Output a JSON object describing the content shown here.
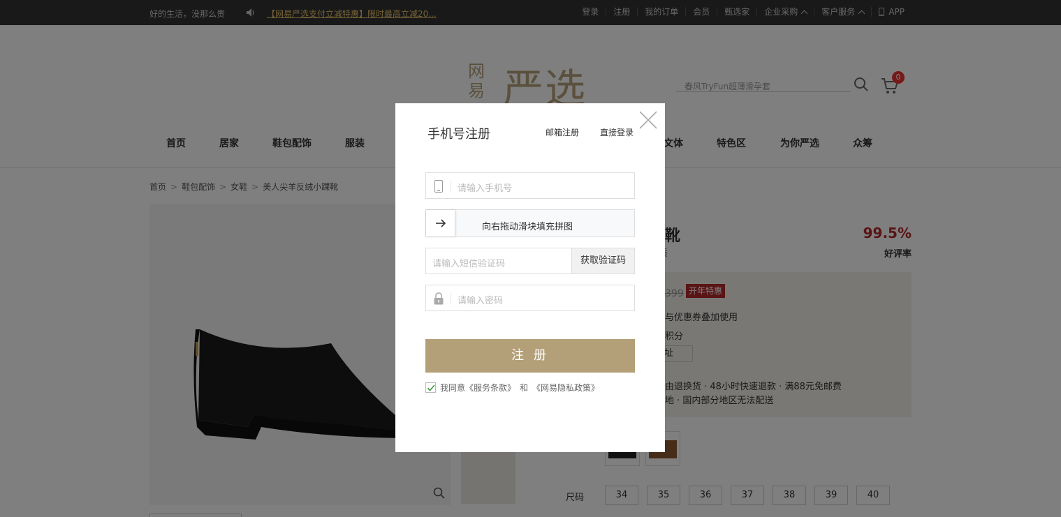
{
  "topbar": {
    "slogan": "好的生活，没那么贵",
    "notice": "【网易严选支付立减特惠】限时最高立减20...",
    "links": {
      "login": "登录",
      "register": "注册",
      "orders": "我的订单",
      "member": "会员",
      "curator": "甄选家",
      "enterprise": "企业采购",
      "service": "客户服务",
      "app": "APP"
    }
  },
  "header": {
    "logo_small": "网易",
    "logo_big": "严选",
    "search_placeholder": "春风TryFun超薄滑孕套",
    "cart_count": "0"
  },
  "nav": [
    "首页",
    "居家",
    "鞋包配饰",
    "服装",
    "文体",
    "特色区",
    "为你严选",
    "众筹"
  ],
  "breadcrumb": [
    "首页",
    "鞋包配饰",
    "女鞋",
    "美人尖羊反绒小踝靴"
  ],
  "product": {
    "title_tail": "踝靴",
    "subtitle_tail": "气质",
    "rate": "99.5%",
    "rate_label": "好评率",
    "old_price_tail": "399",
    "promo_tag": "开年特惠",
    "coupon_tail": "与优惠券叠加使用",
    "points_tail": "积分",
    "addr_tail": "址",
    "service_line1": "由退换货    · 48小时快速退款    · 满88元免邮费",
    "service_line2": "地    · 国内部分地区无法配送",
    "size_label": "尺码",
    "sizes": [
      "34",
      "35",
      "36",
      "37",
      "38",
      "39",
      "40"
    ]
  },
  "modal": {
    "title": "手机号注册",
    "email_register": "邮箱注册",
    "direct_login": "直接登录",
    "phone_placeholder": "请输入手机号",
    "slider_text": "向右拖动滑块填充拼图",
    "sms_placeholder": "请输入短信验证码",
    "get_code": "获取验证码",
    "password_placeholder": "请输入密码",
    "submit": "注 册",
    "agree_prefix": "我同意",
    "terms": "《服务条款》",
    "and": "和",
    "privacy": "《网易隐私政策》"
  },
  "colors": {
    "accent": "#b4a078",
    "price_red": "#b4282d",
    "topbar_bg": "#333333",
    "overlay": "rgba(0,0,0,0.5)"
  }
}
